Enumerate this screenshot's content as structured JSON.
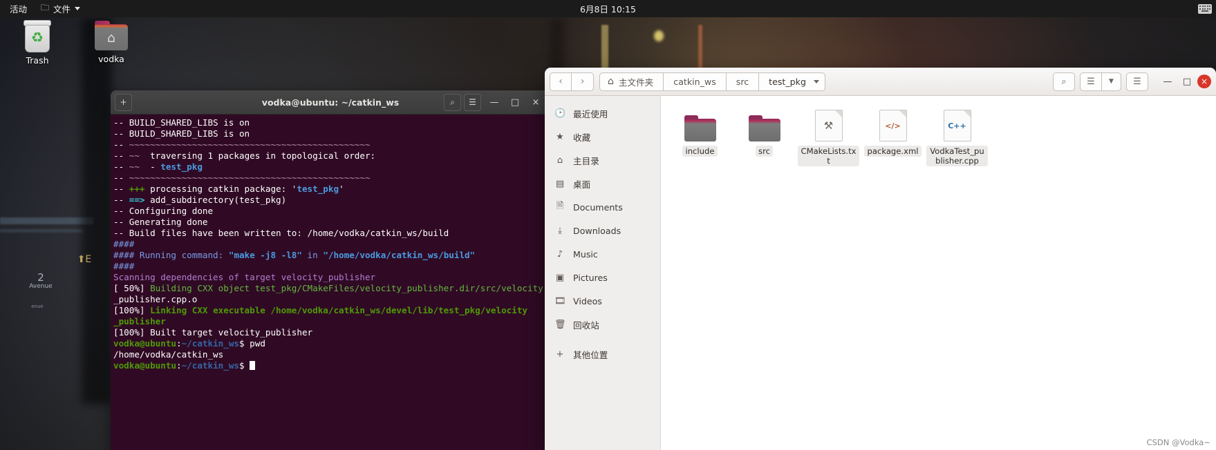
{
  "topbar": {
    "activities": "活动",
    "app_icon": "folder-icon",
    "app_name": "文件",
    "clock": "6月8日  10:15",
    "input_icon": "keyboard-icon"
  },
  "desktop": {
    "icons": [
      {
        "label": "Trash",
        "icon": "trash-icon"
      },
      {
        "label": "vodka",
        "icon": "home-folder-icon"
      }
    ],
    "wallpaper_signs": [
      {
        "line1": "2",
        "line2": "Avenue",
        "line3": "enue"
      },
      {
        "line1": "E",
        "line2": ""
      }
    ]
  },
  "terminal": {
    "title": "vodka@ubuntu: ~/catkin_ws",
    "buttons": {
      "new_tab": "+",
      "search": "search-icon",
      "menu": "hamburger-icon",
      "minimize": "—",
      "maximize": "□",
      "close": "×"
    },
    "lines": [
      [
        {
          "t": "-- BUILD_SHARED_LIBS is on",
          "c": "c-white"
        }
      ],
      [
        {
          "t": "-- BUILD_SHARED_LIBS is on",
          "c": "c-white"
        }
      ],
      [
        {
          "t": "-- ",
          "c": "c-white"
        },
        {
          "t": "~~~~~~~~~~~~~~~~~~~~~~~~~~~~~~~~~~~~~~~~~~~~~~",
          "c": "c-tilde"
        }
      ],
      [
        {
          "t": "-- ",
          "c": "c-white"
        },
        {
          "t": "~~",
          "c": "c-tilde"
        },
        {
          "t": "  traversing 1 packages in topological order:",
          "c": "c-white"
        }
      ],
      [
        {
          "t": "-- ",
          "c": "c-white"
        },
        {
          "t": "~~",
          "c": "c-tilde"
        },
        {
          "t": "  - ",
          "c": "c-white"
        },
        {
          "t": "test_pkg",
          "c": "c-blue"
        }
      ],
      [
        {
          "t": "-- ",
          "c": "c-white"
        },
        {
          "t": "~~~~~~~~~~~~~~~~~~~~~~~~~~~~~~~~~~~~~~~~~~~~~~",
          "c": "c-tilde"
        }
      ],
      [
        {
          "t": "-- ",
          "c": "c-white"
        },
        {
          "t": "+++",
          "c": "c-green"
        },
        {
          "t": " processing catkin package: '",
          "c": "c-white"
        },
        {
          "t": "test_pkg",
          "c": "c-blue"
        },
        {
          "t": "'",
          "c": "c-white"
        }
      ],
      [
        {
          "t": "-- ",
          "c": "c-white"
        },
        {
          "t": "==>",
          "c": "c-cyan"
        },
        {
          "t": " add_subdirectory(test_pkg)",
          "c": "c-white"
        }
      ],
      [
        {
          "t": "-- Configuring done",
          "c": "c-white"
        }
      ],
      [
        {
          "t": "-- Generating done",
          "c": "c-white"
        }
      ],
      [
        {
          "t": "-- Build files have been written to: /home/vodka/catkin_ws/build",
          "c": "c-white"
        }
      ],
      [
        {
          "t": "####",
          "c": "c-hash"
        }
      ],
      [
        {
          "t": "#### Running command: ",
          "c": "c-hash"
        },
        {
          "t": "\"make -j8 -l8\"",
          "c": "c-blue"
        },
        {
          "t": " in ",
          "c": "c-hash"
        },
        {
          "t": "\"/home/vodka/catkin_ws/build\"",
          "c": "c-blue"
        }
      ],
      [
        {
          "t": "####",
          "c": "c-hash"
        }
      ],
      [
        {
          "t": "Scanning dependencies of target velocity_publisher",
          "c": "c-mag"
        }
      ],
      [
        {
          "t": "[ 50%] ",
          "c": "c-white"
        },
        {
          "t": "Building CXX object test_pkg/CMakeFiles/velocity_publisher.dir/src/velocity",
          "c": "c-green2"
        }
      ],
      [
        {
          "t": "_publisher.cpp.o",
          "c": "c-white"
        }
      ],
      [
        {
          "t": "[100%] ",
          "c": "c-white"
        },
        {
          "t": "Linking CXX executable /home/vodka/catkin_ws/devel/lib/test_pkg/velocity",
          "c": "c-green"
        }
      ],
      [
        {
          "t": "_publisher",
          "c": "c-green"
        }
      ],
      [
        {
          "t": "[100%] Built target velocity_publisher",
          "c": "c-white"
        }
      ],
      [
        {
          "t": "vodka@ubuntu",
          "c": "c-prompt"
        },
        {
          "t": ":",
          "c": "c-white"
        },
        {
          "t": "~/catkin_ws",
          "c": "c-path"
        },
        {
          "t": "$ pwd",
          "c": "c-white"
        }
      ],
      [
        {
          "t": "/home/vodka/catkin_ws",
          "c": "c-white"
        }
      ],
      [
        {
          "t": "vodka@ubuntu",
          "c": "c-prompt"
        },
        {
          "t": ":",
          "c": "c-white"
        },
        {
          "t": "~/catkin_ws",
          "c": "c-path"
        },
        {
          "t": "$ ",
          "c": "c-white"
        },
        {
          "t": "",
          "c": "cursor-slot"
        }
      ]
    ]
  },
  "files": {
    "nav": {
      "back": "‹",
      "forward": "›"
    },
    "breadcrumbs": [
      {
        "label": "主文件夹",
        "icon": "home-icon",
        "dropdown": false
      },
      {
        "label": "catkin_ws",
        "dropdown": false
      },
      {
        "label": "src",
        "dropdown": false
      },
      {
        "label": "test_pkg",
        "dropdown": true
      }
    ],
    "header_buttons": {
      "search": "search-icon",
      "list_view": "list-view-icon",
      "view_options": "chevron-down-icon",
      "menu": "hamburger-icon",
      "minimize": "—",
      "maximize": "□",
      "close": "×"
    },
    "sidebar": [
      {
        "label": "最近使用",
        "icon": "clock-icon"
      },
      {
        "label": "收藏",
        "icon": "star-icon"
      },
      {
        "label": "主目录",
        "icon": "home-icon"
      },
      {
        "label": "桌面",
        "icon": "desktop-icon"
      },
      {
        "label": "Documents",
        "icon": "documents-icon"
      },
      {
        "label": "Downloads",
        "icon": "downloads-icon"
      },
      {
        "label": "Music",
        "icon": "music-icon"
      },
      {
        "label": "Pictures",
        "icon": "pictures-icon"
      },
      {
        "label": "Videos",
        "icon": "videos-icon"
      },
      {
        "label": "回收站",
        "icon": "trash-icon"
      },
      {
        "label": "其他位置",
        "icon": "plus-icon"
      }
    ],
    "items": [
      {
        "name": "include",
        "type": "folder",
        "glyph": ""
      },
      {
        "name": "src",
        "type": "folder",
        "glyph": ""
      },
      {
        "name": "CMakeLists.txt",
        "type": "file",
        "glyph": "⚒",
        "kind": "cmk"
      },
      {
        "name": "package.xml",
        "type": "file",
        "glyph": "</>",
        "kind": "xml"
      },
      {
        "name": "VodkaTest_publisher.cpp",
        "type": "file",
        "glyph": "C++",
        "kind": "cpp"
      }
    ]
  },
  "watermark": "CSDN @Vodka~"
}
